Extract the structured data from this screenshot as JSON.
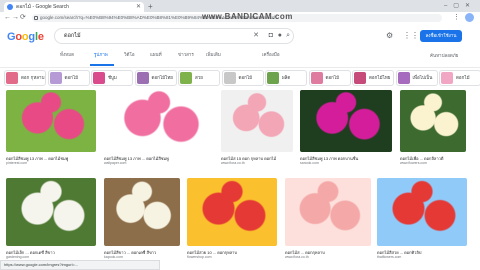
{
  "browser": {
    "tab_title": "ดอกไม้ - Google Search",
    "url": "google.com/search?q=%E0%B8%94%E0%B8%AD%E0%B8%81%E0%B9%84%E0%B8%A1%E0%B9%89&tbm=isch",
    "watermark": "www.BANDICAM.com"
  },
  "search": {
    "logo": "Google",
    "query": "ดอกไม้",
    "tabs": [
      "ทั้งหมด",
      "รูปภาพ",
      "วิดีโอ",
      "แผนที่",
      "ข่าวสาร",
      "เพิ่มเติม"
    ],
    "tools_label": "เครื่องมือ",
    "safesearch_label": "ค้นหาปลอดภัย",
    "signin_label": "ลงชื่อเข้าใช้งาน"
  },
  "chips": [
    {
      "label": "ดอก กุหลาบ",
      "color": "#e36b8a"
    },
    {
      "label": "ดอกไม้",
      "color": "#b59ad6"
    },
    {
      "label": "ชีบูม",
      "color": "#d94b8c"
    },
    {
      "label": "ดอกไม้ไทย",
      "color": "#9b6fb2"
    },
    {
      "label": "สวย",
      "color": "#7fb24a"
    },
    {
      "label": "ดอกไม้",
      "color": "#c8c8c8"
    },
    {
      "label": "ผลิต",
      "color": "#6da34d"
    },
    {
      "label": "ดอกไม้",
      "color": "#e07ba0"
    },
    {
      "label": "ดอกไม้ไทย",
      "color": "#c64a7a"
    },
    {
      "label": "เพื่อไปเป็น",
      "color": "#a66bbf"
    },
    {
      "label": "ดอกไม้",
      "color": "#f1a7c4"
    }
  ],
  "results": [
    {
      "caption": "ดอกไม้สีชมพู 13 ภาพ ... ดอกไม้ชมพู",
      "source": "pinterest.com",
      "color": "#e84a86",
      "accent": "#7cb342"
    },
    {
      "caption": "ดอกไม้สีชมพู 13 ภาพ ... ดอกไม้สีชมพู",
      "source": "wallpaper.com",
      "color": "#f06fa0",
      "accent": "#ffffff"
    },
    {
      "caption": "ดอกไม้ส 15 ดอก กุหลาบ ดอกไม้",
      "source": "www.flora.co.th",
      "color": "#f3a6b6",
      "accent": "#f0f0f0"
    },
    {
      "caption": "ดอกไม้สีชมพู 13 ภาพ ดอกบานชื่น",
      "source": "sanook.com",
      "color": "#d41d9a",
      "accent": "#1f3d1f"
    },
    {
      "caption": "ดอกไม้เพื่อ ... ดอกลีลาวดี",
      "source": "www.flowers.com",
      "color": "#fbf2d0",
      "accent": "#3d6b2f"
    },
    {
      "caption": "ดอกไม้เล็ก ... ดอกเดซี่ สีขาว",
      "source": "gardening.com",
      "color": "#f5f5ee",
      "accent": "#4f7a33"
    },
    {
      "caption": "ดอกไม้สีขาว ... ดอกเดซี่ สีขาว",
      "source": "kapook.com",
      "color": "#f7f3e3",
      "accent": "#8d6e4a"
    },
    {
      "caption": "ดอกไม้สวย 10 ... ดอกกุหลาบ",
      "source": "flowershop.com",
      "color": "#e53935",
      "accent": "#fbc02d"
    },
    {
      "caption": "ดอกไม้ส ... ดอกกุหลาบ",
      "source": "www.flora.co.th",
      "color": "#f4a9a8",
      "accent": "#fde0dc"
    },
    {
      "caption": "ดอกไม้สีสวย ... ดอกทิวลิป",
      "source": "thaiflowers.com",
      "color": "#e53935",
      "accent": "#90caf9"
    }
  ],
  "status_text": "https://www.google.com/imgres?imgurl=..."
}
